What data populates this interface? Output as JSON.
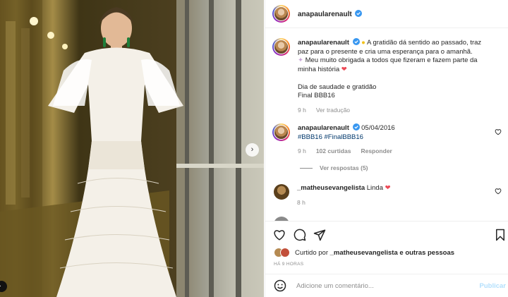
{
  "post": {
    "username": "anapaularenault",
    "caption": {
      "line1": "A gratidão dá sentido ao passado, traz paz para o presente e cria uma esperança para o amanhã.",
      "line2": "Meu muito obrigada a todos que fizeram e fazem parte da minha história",
      "line3": "Dia de saudade e gratidão",
      "line4": "Final BBB16",
      "time": "9 h",
      "translate": "Ver tradução"
    },
    "comments": [
      {
        "username": "anapaularenault",
        "date": "05/04/2016",
        "hashtags": "#BBB16 #FinalBBB16",
        "time": "9 h",
        "likes": "102 curtidas",
        "reply": "Responder",
        "view_replies": "Ver respostas (5)"
      },
      {
        "username": "_matheusevangelista",
        "text": "Linda",
        "time": "8 h"
      }
    ],
    "liked_by": {
      "prefix": "Curtido por",
      "user": "_matheusevangelista",
      "suffix": "e outras pessoas"
    },
    "timestamp": "HÁ 9 HORAS",
    "add_comment_placeholder": "Adicione um comentário...",
    "publish_label": "Publicar"
  },
  "colors": {
    "verified": "#3897f0",
    "heart": "#ed4956",
    "hashtag": "#00376b",
    "publish_disabled": "#b2dffc"
  },
  "icons": [
    "verified-icon",
    "heart-icon",
    "comment-icon",
    "share-icon",
    "bookmark-icon",
    "emoji-icon",
    "chevron-right-icon"
  ]
}
